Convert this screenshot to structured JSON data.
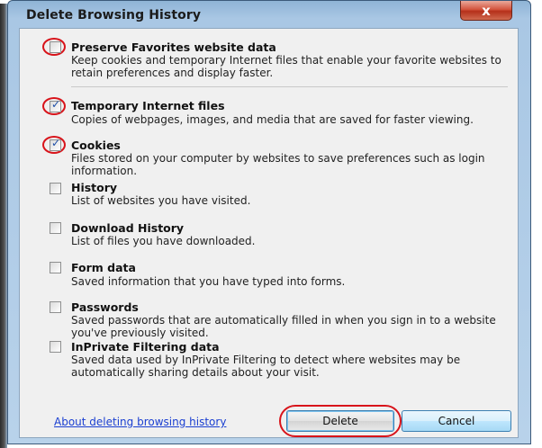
{
  "window": {
    "title": "Delete Browsing History",
    "close_glyph": "x"
  },
  "options": [
    {
      "label": "Preserve Favorites website data",
      "description": "Keep cookies and temporary Internet files that enable your favorite websites to retain preferences and display faster.",
      "checked": false,
      "highlighted": true
    },
    {
      "label": "Temporary Internet files",
      "description": "Copies of webpages, images, and media that are saved for faster viewing.",
      "checked": true,
      "highlighted": true
    },
    {
      "label": "Cookies",
      "description": "Files stored on your computer by websites to save preferences such as login information.",
      "checked": true,
      "highlighted": true
    },
    {
      "label": "History",
      "description": "List of websites you have visited.",
      "checked": false,
      "highlighted": false
    },
    {
      "label": "Download History",
      "description": "List of files you have downloaded.",
      "checked": false,
      "highlighted": false
    },
    {
      "label": "Form data",
      "description": "Saved information that you have typed into forms.",
      "checked": false,
      "highlighted": false
    },
    {
      "label": "Passwords",
      "description": "Saved passwords that are automatically filled in when you sign in to a website you've previously visited.",
      "checked": false,
      "highlighted": false
    },
    {
      "label": "InPrivate Filtering data",
      "description": "Saved data used by InPrivate Filtering to detect where websites may be automatically sharing details about your visit.",
      "checked": false,
      "highlighted": false
    }
  ],
  "footer": {
    "link": "About deleting browsing history",
    "delete_label": "Delete",
    "cancel_label": "Cancel"
  },
  "colors": {
    "highlight": "#d8141b",
    "link": "#1a3fd1",
    "accent": "#3c7fb1"
  }
}
